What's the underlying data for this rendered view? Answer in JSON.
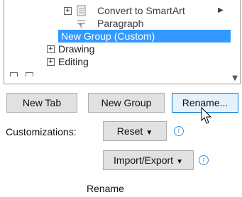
{
  "tree": {
    "items": [
      {
        "label": "Convert to SmartArt",
        "has_submenu": true
      },
      {
        "label": "Paragraph"
      },
      {
        "label": "New Group (Custom)",
        "selected": true
      },
      {
        "label": "Drawing"
      },
      {
        "label": "Editing"
      }
    ]
  },
  "buttons": {
    "new_tab": {
      "label": "New Tab"
    },
    "new_group": {
      "label": "New Group"
    },
    "rename": {
      "label": "Rename..."
    },
    "reset": {
      "label": "Reset"
    },
    "import_export": {
      "label": "Import/Export"
    }
  },
  "customizations_label": "Customizations:",
  "tooltip": "Rename",
  "colors": {
    "selection": "#3399ff",
    "accent": "#0078d7",
    "info": "#4a90e2"
  },
  "icons": [
    "expand-plus-icon",
    "document-icon",
    "paragraph-icon",
    "submenu-arrow-icon",
    "scroll-down-icon",
    "dropdown-caret-icon",
    "info-icon",
    "mouse-cursor-icon"
  ]
}
